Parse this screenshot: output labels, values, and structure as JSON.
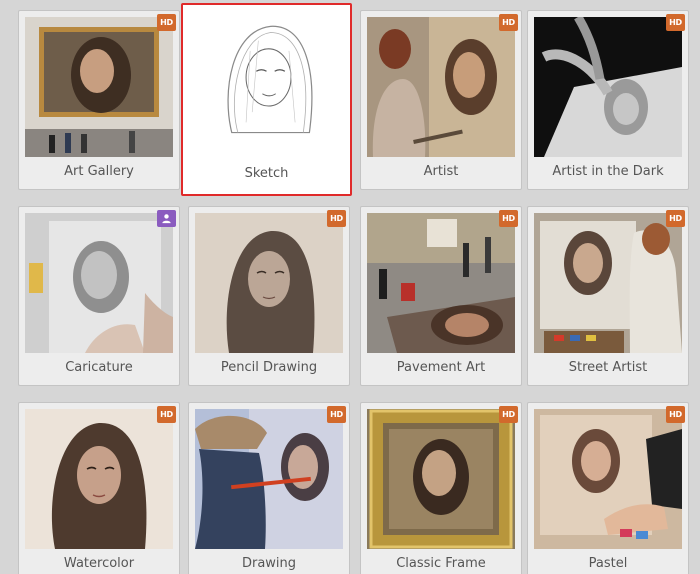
{
  "colors": {
    "hd_badge": "#d2692c",
    "user_badge": "#8a5bbf",
    "selected_border": "#e02a2a"
  },
  "effects": [
    {
      "label": "Art Gallery",
      "badge": "HD",
      "selected": false,
      "icon": "art-gallery-thumbnail"
    },
    {
      "label": "Sketch",
      "badge": "",
      "selected": true,
      "icon": "sketch-thumbnail"
    },
    {
      "label": "Artist",
      "badge": "HD",
      "selected": false,
      "icon": "artist-thumbnail"
    },
    {
      "label": "Artist in the Dark",
      "badge": "HD",
      "selected": false,
      "icon": "artist-in-the-dark-thumbnail"
    },
    {
      "label": "Caricature",
      "badge": "user-icon",
      "selected": false,
      "icon": "caricature-thumbnail"
    },
    {
      "label": "Pencil Drawing",
      "badge": "HD",
      "selected": false,
      "icon": "pencil-drawing-thumbnail"
    },
    {
      "label": "Pavement Art",
      "badge": "HD",
      "selected": false,
      "icon": "pavement-art-thumbnail"
    },
    {
      "label": "Street Artist",
      "badge": "HD",
      "selected": false,
      "icon": "street-artist-thumbnail"
    },
    {
      "label": "Watercolor",
      "badge": "HD",
      "selected": false,
      "icon": "watercolor-thumbnail"
    },
    {
      "label": "Drawing",
      "badge": "HD",
      "selected": false,
      "icon": "drawing-thumbnail"
    },
    {
      "label": "Classic Frame",
      "badge": "HD",
      "selected": false,
      "icon": "classic-frame-thumbnail"
    },
    {
      "label": "Pastel",
      "badge": "HD",
      "selected": false,
      "icon": "pastel-thumbnail"
    }
  ]
}
